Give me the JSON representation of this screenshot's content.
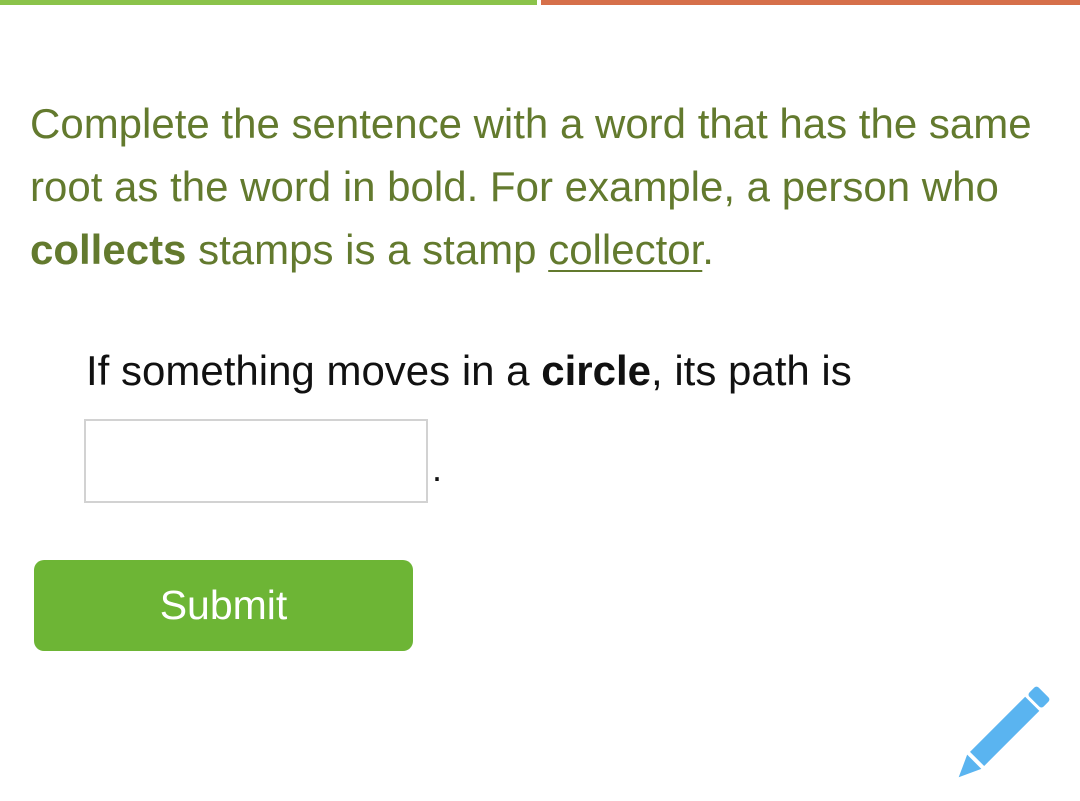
{
  "theme": {
    "progress_left_color": "#8bc34a",
    "progress_right_color": "#d6704a",
    "instruction_color": "#637a2e",
    "button_color": "#6db535",
    "pencil_color": "#5ab4f0"
  },
  "instructions": {
    "line_a": "Complete the sentence with a word that has the same root as the word in bold. For example, a person who ",
    "bold_word": "collects",
    "line_b": " stamps is a stamp ",
    "underlined_word": "collector",
    "end": "."
  },
  "question": {
    "prefix": "If something moves in a ",
    "bold_word": "circle",
    "suffix": ", its path is"
  },
  "answer": {
    "value": "",
    "placeholder": "",
    "trailing_punctuation": "."
  },
  "submit_label": "Submit",
  "icons": {
    "pencil": "pencil-icon"
  }
}
